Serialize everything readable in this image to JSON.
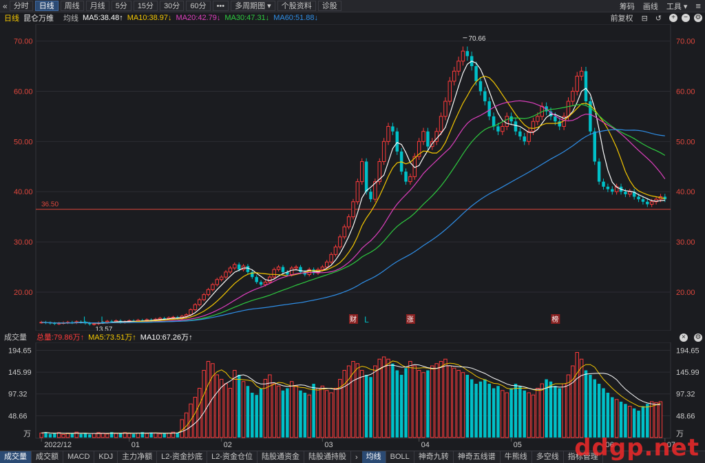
{
  "toolbar": {
    "back_icon": "«",
    "tabs": [
      {
        "label": "分时",
        "active": false
      },
      {
        "label": "日线",
        "active": true
      },
      {
        "label": "周线",
        "active": false
      },
      {
        "label": "月线",
        "active": false
      },
      {
        "label": "5分",
        "active": false
      },
      {
        "label": "15分",
        "active": false
      },
      {
        "label": "30分",
        "active": false
      },
      {
        "label": "60分",
        "active": false
      },
      {
        "label": "•••",
        "active": false
      },
      {
        "label": "多周期图 ▾",
        "active": false
      },
      {
        "label": "个股资料",
        "active": false
      },
      {
        "label": "诊股",
        "active": false
      }
    ],
    "right": [
      "筹码",
      "画线",
      "工具 ▾"
    ],
    "menu_icon": "≡"
  },
  "legend": {
    "period": "日线",
    "name": "昆仑万维",
    "label": "均线",
    "ma5": "MA5:38.48↑",
    "ma10": "MA10:38.97↓",
    "ma20": "MA20:42.79↓",
    "ma30": "MA30:47.31↓",
    "ma60": "MA60:51.88↓",
    "right_label": "前复权"
  },
  "price_axis": [
    "70.00",
    "60.00",
    "50.00",
    "40.00",
    "30.00",
    "20.00"
  ],
  "support_line_label": "36.50",
  "high_label": "70.66",
  "low_label": "13.57",
  "event_markers": [
    {
      "label": "L",
      "type": "text"
    },
    {
      "label": "L",
      "type": "text"
    },
    {
      "label": "财",
      "type": "box"
    },
    {
      "label": "L",
      "type": "text"
    },
    {
      "label": "涨",
      "type": "box"
    },
    {
      "label": "榜",
      "type": "box"
    }
  ],
  "volume_legend": {
    "title": "成交量",
    "total": "总量:79.86万↑",
    "ma5": "MA5:73.51万↑",
    "ma10": "MA10:67.26万↑"
  },
  "volume_axis": [
    "194.65",
    "145.99",
    "97.32",
    "48.66",
    "万"
  ],
  "date_labels": [
    "2022/12",
    "01",
    "02",
    "03",
    "04",
    "05",
    "06",
    "07"
  ],
  "bottom_tabs_left": [
    "成交量",
    "成交额",
    "MACD",
    "KDJ",
    "主力净额",
    "L2-资金抄底",
    "L2-资金仓位",
    "陆股通资金",
    "陆股通持股"
  ],
  "bottom_tabs_right": [
    "均线",
    "BOLL",
    "神奇九转",
    "神奇五线谱",
    "牛熊线",
    "多空线",
    "指标管理"
  ],
  "watermark": "ddgp.net",
  "colors": {
    "up": "#ff3b3b",
    "down": "#00c0c8",
    "ma5": "#ffffff",
    "ma10": "#f5c800",
    "ma20": "#e040c0",
    "ma30": "#2ecc40",
    "ma60": "#2f8fe8"
  },
  "chart_data": {
    "type": "candlestick",
    "title": "昆仑万维 日线",
    "ylim": [
      13,
      72
    ],
    "y_ticks": [
      20,
      30,
      40,
      50,
      60,
      70
    ],
    "support_level": 36.5,
    "high": 70.66,
    "low": 13.57,
    "close_series": [
      14.0,
      13.9,
      13.8,
      13.7,
      13.8,
      13.9,
      14.0,
      13.9,
      14.1,
      14.0,
      13.8,
      13.6,
      13.7,
      13.9,
      14.0,
      14.2,
      14.1,
      14.3,
      14.0,
      14.1,
      14.3,
      14.2,
      14.4,
      14.3,
      14.5,
      14.4,
      14.6,
      14.8,
      14.7,
      14.9,
      15.0,
      14.8,
      15.2,
      15.5,
      16.5,
      17.5,
      18.5,
      19.5,
      20.5,
      21.5,
      22.5,
      23.0,
      24.0,
      24.8,
      25.5,
      24.5,
      25.2,
      24.0,
      23.0,
      22.0,
      21.5,
      22.0,
      23.0,
      24.5,
      25.0,
      24.0,
      23.5,
      24.8,
      25.0,
      24.0,
      23.5,
      24.5,
      23.8,
      24.5,
      25.0,
      26.0,
      27.5,
      29.0,
      31.0,
      33.0,
      35.0,
      38.0,
      42.0,
      46.0,
      40.0,
      38.5,
      42.0,
      46.0,
      50.0,
      53.0,
      52.0,
      48.0,
      44.0,
      42.0,
      43.0,
      47.0,
      50.0,
      52.0,
      49.0,
      50.0,
      52.0,
      55.0,
      58.0,
      62.0,
      64.0,
      66.0,
      68.0,
      67.0,
      65.0,
      62.0,
      60.0,
      58.0,
      55.0,
      53.0,
      52.0,
      53.0,
      55.0,
      54.0,
      52.0,
      51.0,
      50.0,
      52.0,
      54.0,
      55.0,
      57.0,
      56.0,
      55.0,
      54.0,
      53.0,
      55.0,
      58.0,
      60.0,
      63.0,
      64.0,
      58.0,
      52.0,
      46.0,
      42.0,
      41.0,
      40.5,
      40.0,
      41.0,
      40.0,
      39.5,
      40.0,
      39.0,
      38.5,
      38.0,
      37.5,
      38.0,
      38.5,
      39.0,
      38.5
    ],
    "ma_lines": [
      {
        "name": "MA5",
        "last": 38.48
      },
      {
        "name": "MA10",
        "last": 38.97
      },
      {
        "name": "MA20",
        "last": 42.79
      },
      {
        "name": "MA30",
        "last": 47.31
      },
      {
        "name": "MA60",
        "last": 51.88
      }
    ],
    "volume": {
      "ylim": [
        0,
        200
      ],
      "y_ticks": [
        48.66,
        97.32,
        145.99,
        194.65
      ],
      "values": [
        10,
        12,
        8,
        9,
        11,
        7,
        10,
        9,
        12,
        8,
        10,
        7,
        9,
        11,
        10,
        8,
        12,
        9,
        10,
        11,
        9,
        8,
        10,
        12,
        9,
        11,
        10,
        8,
        9,
        10,
        12,
        11,
        40,
        55,
        75,
        90,
        110,
        150,
        170,
        165,
        140,
        130,
        120,
        110,
        150,
        140,
        125,
        115,
        100,
        95,
        110,
        130,
        140,
        120,
        115,
        105,
        110,
        125,
        115,
        105,
        100,
        95,
        120,
        110,
        115,
        105,
        100,
        110,
        130,
        150,
        160,
        170,
        165,
        150,
        140,
        135,
        160,
        175,
        180,
        175,
        165,
        150,
        140,
        155,
        170,
        160,
        150,
        145,
        150,
        160,
        165,
        170,
        175,
        160,
        155,
        150,
        145,
        140,
        130,
        120,
        125,
        130,
        120,
        110,
        115,
        105,
        100,
        110,
        120,
        115,
        105,
        100,
        95,
        110,
        120,
        130,
        125,
        115,
        110,
        120,
        140,
        160,
        190,
        175,
        150,
        140,
        130,
        120,
        110,
        100,
        90,
        85,
        80,
        75,
        70,
        65,
        60,
        70,
        75,
        80,
        78,
        80
      ]
    },
    "x_labels": [
      "2022/12",
      "01",
      "02",
      "03",
      "04",
      "05",
      "06",
      "07"
    ]
  }
}
